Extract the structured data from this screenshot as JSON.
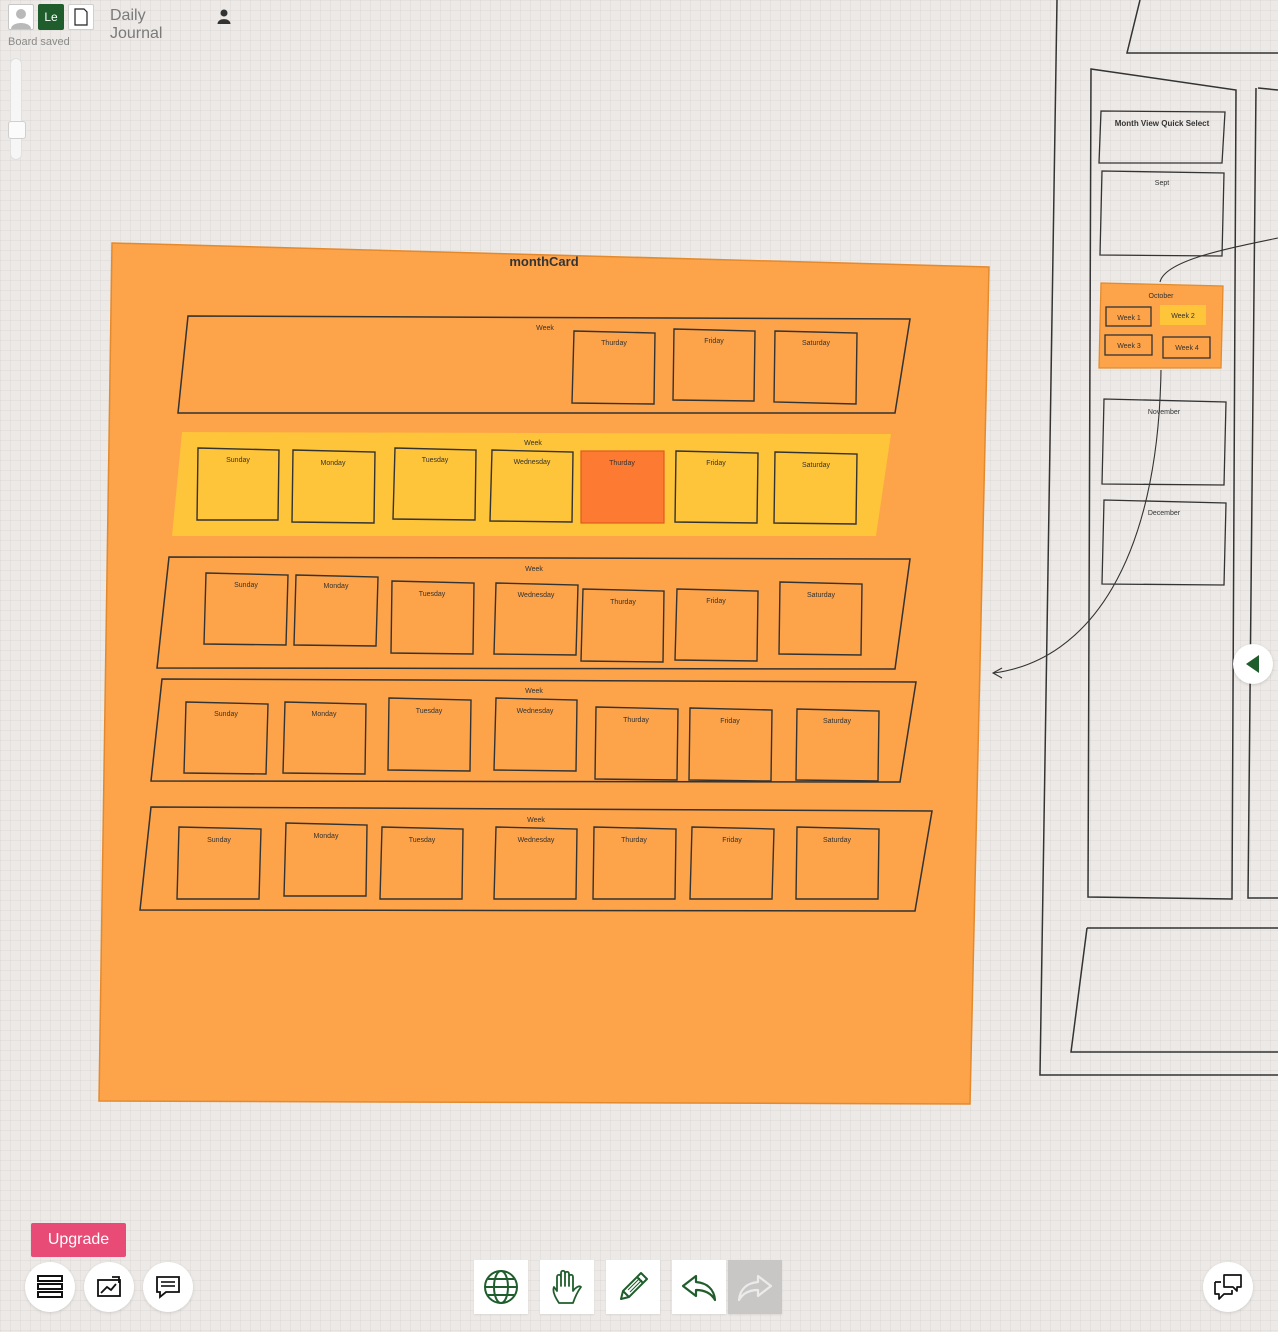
{
  "header": {
    "initials": "Le",
    "board_title": "Daily Journal",
    "save_status": "Board saved"
  },
  "month_card": {
    "title": "monthCard",
    "fill_color": "#fda349",
    "week_label": "Week",
    "day_labels": [
      "Sunday",
      "Monday",
      "Tuesday",
      "Wednesday",
      "Thurday",
      "Friday",
      "Saturday"
    ],
    "day_labels_alt_thursday": "Thurday",
    "highlight_week_color": "#fec43a",
    "highlight_day_color": "#fd7a33"
  },
  "quick_select": {
    "title": "Month View Quick Select",
    "months": [
      "Sept",
      "October",
      "November",
      "December"
    ],
    "october_weeks": [
      "Week 1",
      "Week 2",
      "Week 3",
      "Week 4"
    ]
  },
  "footer": {
    "upgrade_label": "Upgrade"
  },
  "toolbar": {
    "tools": [
      "globe-icon",
      "hand-icon",
      "pencil-icon",
      "undo-icon",
      "redo-icon"
    ]
  },
  "colors": {
    "accent": "#1f5e2c",
    "upgrade": "#e84b76"
  }
}
